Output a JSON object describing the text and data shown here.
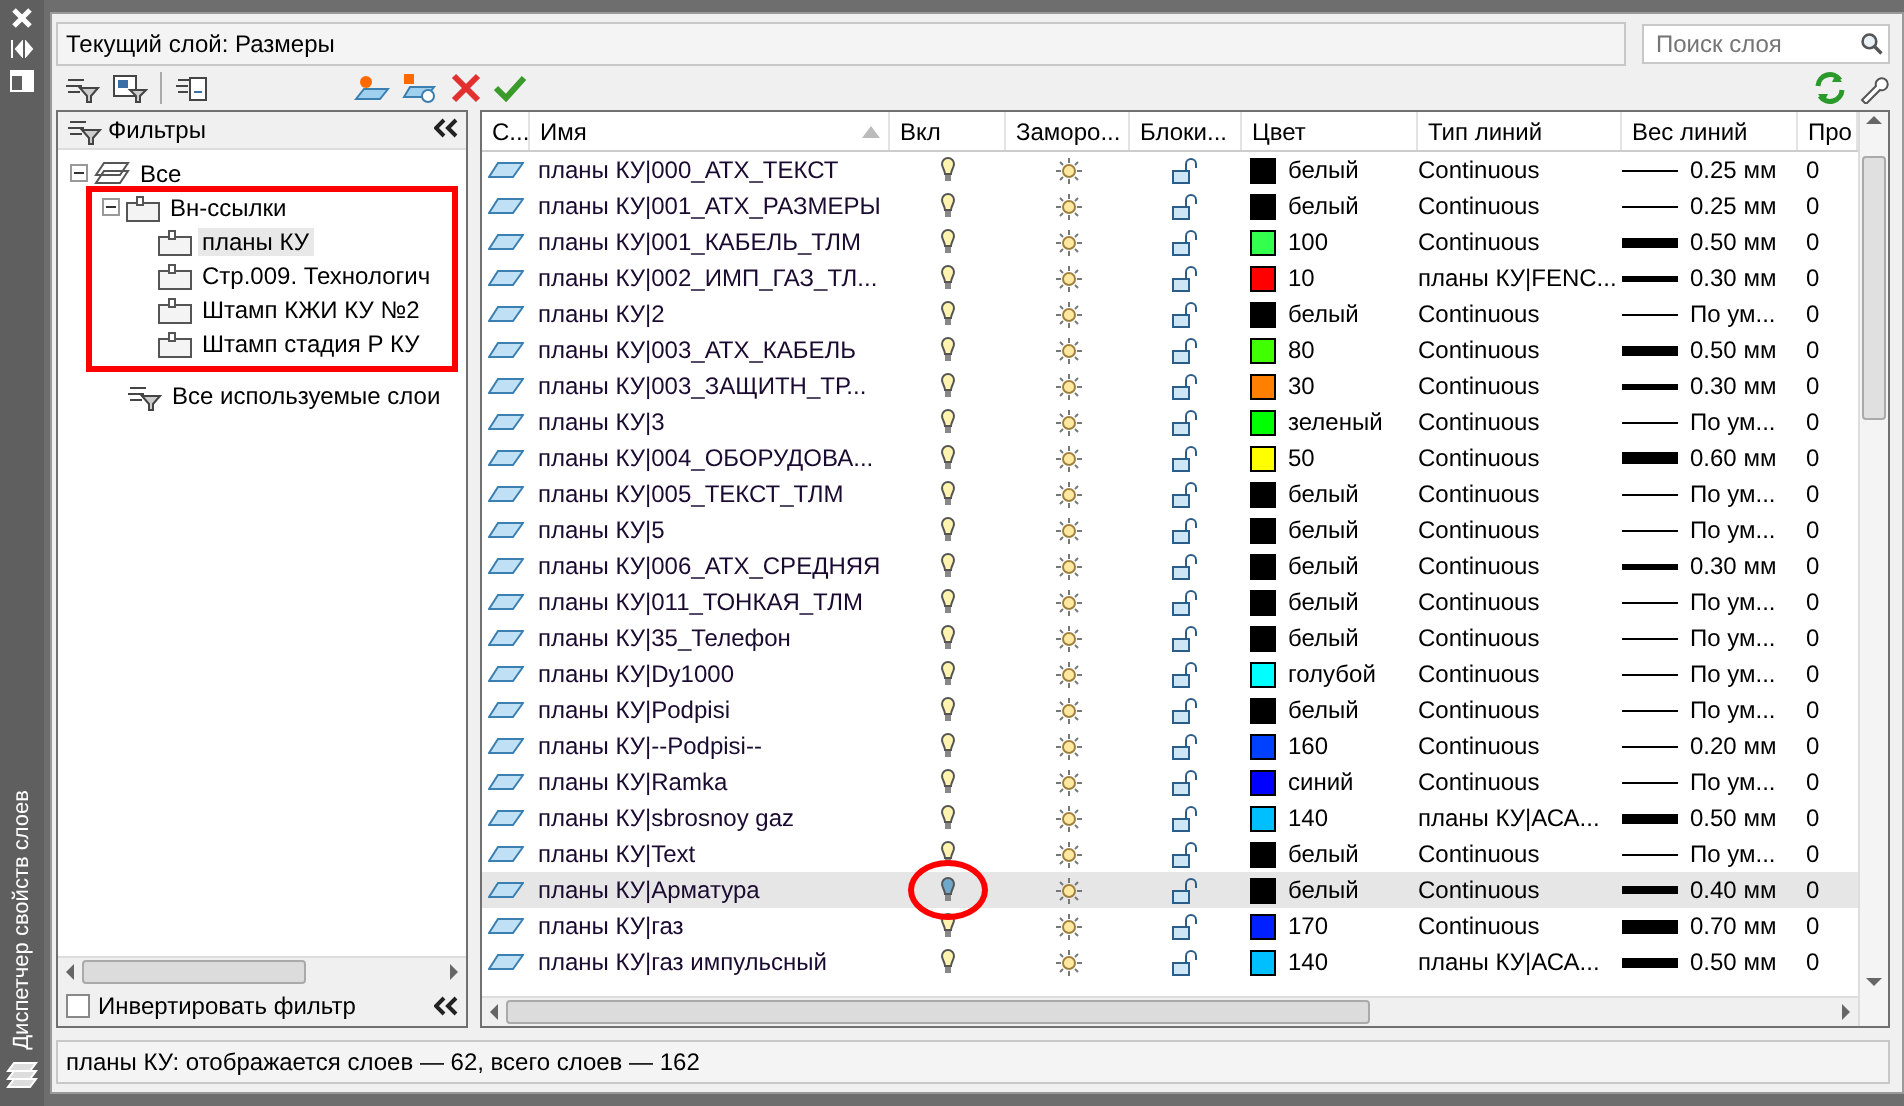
{
  "side_strip": {
    "title": "Диспетчер свойств слоев"
  },
  "current_layer": "Текущий слой: Размеры",
  "search": {
    "placeholder": "Поиск слоя"
  },
  "filters": {
    "title": "Фильтры",
    "tree": [
      {
        "label": "Все",
        "kind": "all",
        "expanded": true,
        "children": [
          {
            "label": "Вн-ссылки",
            "kind": "xref",
            "expanded": true,
            "children": [
              {
                "label": "планы КУ",
                "kind": "xref",
                "selected": true
              },
              {
                "label": "Стр.009. Технологич",
                "kind": "xref",
                "selected": false
              },
              {
                "label": "Штамп КЖИ КУ №2",
                "kind": "xref",
                "selected": false
              },
              {
                "label": "Штамп стадия Р КУ",
                "kind": "xref",
                "selected": false
              }
            ]
          },
          {
            "label": "Все используемые слои",
            "kind": "filter"
          }
        ]
      }
    ],
    "invert": {
      "label": "Инвертировать фильтр",
      "checked": false
    }
  },
  "table": {
    "columns": [
      "С...",
      "Имя",
      "Вкл",
      "Заморо...",
      "Блоки...",
      "Цвет",
      "Тип линий",
      "Вес линий",
      "Про"
    ],
    "rows": [
      {
        "name": "планы КУ|000_АТХ_ТЕКСТ",
        "on": true,
        "frozen": false,
        "locked": false,
        "color": "#000000",
        "color_name": "белый",
        "linetype": "Continuous",
        "kind": "thin",
        "lineweight": "0.25 мм",
        "plot_style": "0",
        "selected": false
      },
      {
        "name": "планы КУ|001_АТХ_РАЗМЕРЫ",
        "on": true,
        "frozen": false,
        "locked": false,
        "color": "#000000",
        "color_name": "белый",
        "linetype": "Continuous",
        "kind": "thin",
        "lineweight": "0.25 мм",
        "plot_style": "0",
        "selected": false
      },
      {
        "name": "планы КУ|001_КАБЕЛЬ_ТЛМ",
        "on": true,
        "frozen": false,
        "locked": false,
        "color": "#33ff4d",
        "color_name": "100",
        "linetype": "Continuous",
        "kind": "bold",
        "lineweight": "0.50 мм",
        "plot_style": "0",
        "selected": false
      },
      {
        "name": "планы КУ|002_ИМП_ГАЗ_ТЛ...",
        "on": true,
        "frozen": false,
        "locked": false,
        "color": "#ff0000",
        "color_name": "10",
        "linetype": "планы КУ|FENC...",
        "kind": "medium",
        "lineweight": "0.30 мм",
        "plot_style": "0",
        "selected": false
      },
      {
        "name": "планы КУ|2",
        "on": true,
        "frozen": false,
        "locked": false,
        "color": "#000000",
        "color_name": "белый",
        "linetype": "Continuous",
        "kind": "thin",
        "lineweight": "По ум...",
        "plot_style": "0",
        "selected": false
      },
      {
        "name": "планы КУ|003_АТХ_КАБЕЛЬ",
        "on": true,
        "frozen": false,
        "locked": false,
        "color": "#3fff00",
        "color_name": "80",
        "linetype": "Continuous",
        "kind": "bold",
        "lineweight": "0.50 мм",
        "plot_style": "0",
        "selected": false
      },
      {
        "name": "планы КУ|003_ЗАЩИТН_ТР...",
        "on": true,
        "frozen": false,
        "locked": false,
        "color": "#ff7f00",
        "color_name": "30",
        "linetype": "Continuous",
        "kind": "medium",
        "lineweight": "0.30 мм",
        "plot_style": "0",
        "selected": false
      },
      {
        "name": "планы КУ|3",
        "on": true,
        "frozen": false,
        "locked": false,
        "color": "#00ff00",
        "color_name": "зеленый",
        "linetype": "Continuous",
        "kind": "thin",
        "lineweight": "По ум...",
        "plot_style": "0",
        "selected": false
      },
      {
        "name": "планы КУ|004_ОБОРУДОВА...",
        "on": true,
        "frozen": false,
        "locked": false,
        "color": "#ffff00",
        "color_name": "50",
        "linetype": "Continuous",
        "kind": "heavy",
        "lineweight": "0.60 мм",
        "plot_style": "0",
        "selected": false
      },
      {
        "name": "планы КУ|005_ТЕКСТ_ТЛМ",
        "on": true,
        "frozen": false,
        "locked": false,
        "color": "#000000",
        "color_name": "белый",
        "linetype": "Continuous",
        "kind": "thin",
        "lineweight": "По ум...",
        "plot_style": "0",
        "selected": false
      },
      {
        "name": "планы КУ|5",
        "on": true,
        "frozen": false,
        "locked": false,
        "color": "#000000",
        "color_name": "белый",
        "linetype": "Continuous",
        "kind": "thin",
        "lineweight": "По ум...",
        "plot_style": "0",
        "selected": false
      },
      {
        "name": "планы КУ|006_АТХ_СРЕДНЯЯ",
        "on": true,
        "frozen": false,
        "locked": false,
        "color": "#000000",
        "color_name": "белый",
        "linetype": "Continuous",
        "kind": "medium",
        "lineweight": "0.30 мм",
        "plot_style": "0",
        "selected": false
      },
      {
        "name": "планы КУ|011_ТОНКАЯ_ТЛМ",
        "on": true,
        "frozen": false,
        "locked": false,
        "color": "#000000",
        "color_name": "белый",
        "linetype": "Continuous",
        "kind": "thin",
        "lineweight": "По ум...",
        "plot_style": "0",
        "selected": false
      },
      {
        "name": "планы КУ|35_Телефон",
        "on": true,
        "frozen": false,
        "locked": false,
        "color": "#000000",
        "color_name": "белый",
        "linetype": "Continuous",
        "kind": "thin",
        "lineweight": "По ум...",
        "plot_style": "0",
        "selected": false
      },
      {
        "name": "планы КУ|Dy1000",
        "on": true,
        "frozen": false,
        "locked": false,
        "color": "#00ffff",
        "color_name": "голубой",
        "linetype": "Continuous",
        "kind": "thin",
        "lineweight": "По ум...",
        "plot_style": "0",
        "selected": false
      },
      {
        "name": "планы КУ|Podpisi",
        "on": true,
        "frozen": false,
        "locked": false,
        "color": "#000000",
        "color_name": "белый",
        "linetype": "Continuous",
        "kind": "thin",
        "lineweight": "По ум...",
        "plot_style": "0",
        "selected": false
      },
      {
        "name": "планы КУ|--Podpisi--",
        "on": true,
        "frozen": false,
        "locked": false,
        "color": "#0040ff",
        "color_name": "160",
        "linetype": "Continuous",
        "kind": "thin",
        "lineweight": "0.20 мм",
        "plot_style": "0",
        "selected": false
      },
      {
        "name": "планы КУ|Ramka",
        "on": true,
        "frozen": false,
        "locked": false,
        "color": "#0000ff",
        "color_name": "синий",
        "linetype": "Continuous",
        "kind": "thin",
        "lineweight": "По ум...",
        "plot_style": "0",
        "selected": false
      },
      {
        "name": "планы КУ|sbrosnoy gaz",
        "on": true,
        "frozen": false,
        "locked": false,
        "color": "#00bfff",
        "color_name": "140",
        "linetype": "планы КУ|АСА...",
        "kind": "bold",
        "lineweight": "0.50 мм",
        "plot_style": "0",
        "selected": false
      },
      {
        "name": "планы КУ|Text",
        "on": true,
        "frozen": false,
        "locked": false,
        "color": "#000000",
        "color_name": "белый",
        "linetype": "Continuous",
        "kind": "thin",
        "lineweight": "По ум...",
        "plot_style": "0",
        "selected": false
      },
      {
        "name": "планы КУ|Арматура",
        "on": false,
        "frozen": false,
        "locked": false,
        "color": "#000000",
        "color_name": "белый",
        "linetype": "Continuous",
        "kind": "semibold",
        "lineweight": "0.40 мм",
        "plot_style": "0",
        "selected": true
      },
      {
        "name": "планы КУ|газ",
        "on": true,
        "frozen": false,
        "locked": false,
        "color": "#0020ff",
        "color_name": "170",
        "linetype": "Continuous",
        "kind": "heaviest",
        "lineweight": "0.70 мм",
        "plot_style": "0",
        "selected": false
      },
      {
        "name": "планы КУ|газ импульсный",
        "on": true,
        "frozen": false,
        "locked": false,
        "color": "#00bfff",
        "color_name": "140",
        "linetype": "планы КУ|АСА...",
        "kind": "bold",
        "lineweight": "0.50 мм",
        "plot_style": "0",
        "selected": false
      }
    ]
  },
  "status_bar": "планы КУ: отображается слоев — 62, всего слоев — 162"
}
